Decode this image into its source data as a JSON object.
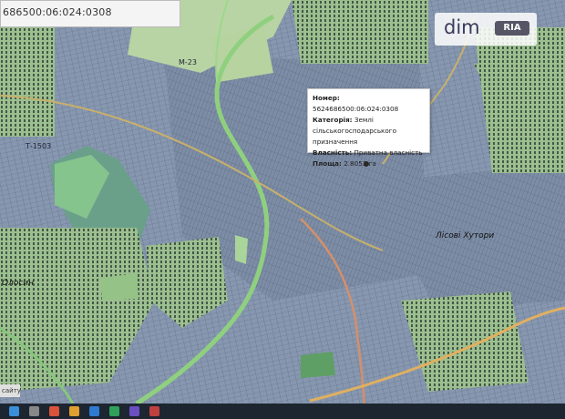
{
  "search": {
    "value": "686500:06:024:0308"
  },
  "watermark": {
    "brand": "dim",
    "tag": "RIA"
  },
  "popup": {
    "rows": [
      {
        "key": "Номер:",
        "value": "5624686500:06:024:0308"
      },
      {
        "key": "Категорія:",
        "value": "Землі сільськогосподарського призначення"
      },
      {
        "key": "Власність:",
        "value": "Приватна власність"
      },
      {
        "key": "Площа:",
        "value": "2.8053 га"
      }
    ]
  },
  "map_labels": {
    "road_label_1": "М-23",
    "road_label_2": "Т-1503",
    "place_1": "Лісові Хутори",
    "place_2": "Олосин"
  },
  "attribution": "сайту",
  "colors": {
    "parcel": "#8696ae",
    "forest": "#6ba38b",
    "field": "#a6cf9c",
    "road": "#86c77b",
    "road_orange": "#e0b060"
  }
}
